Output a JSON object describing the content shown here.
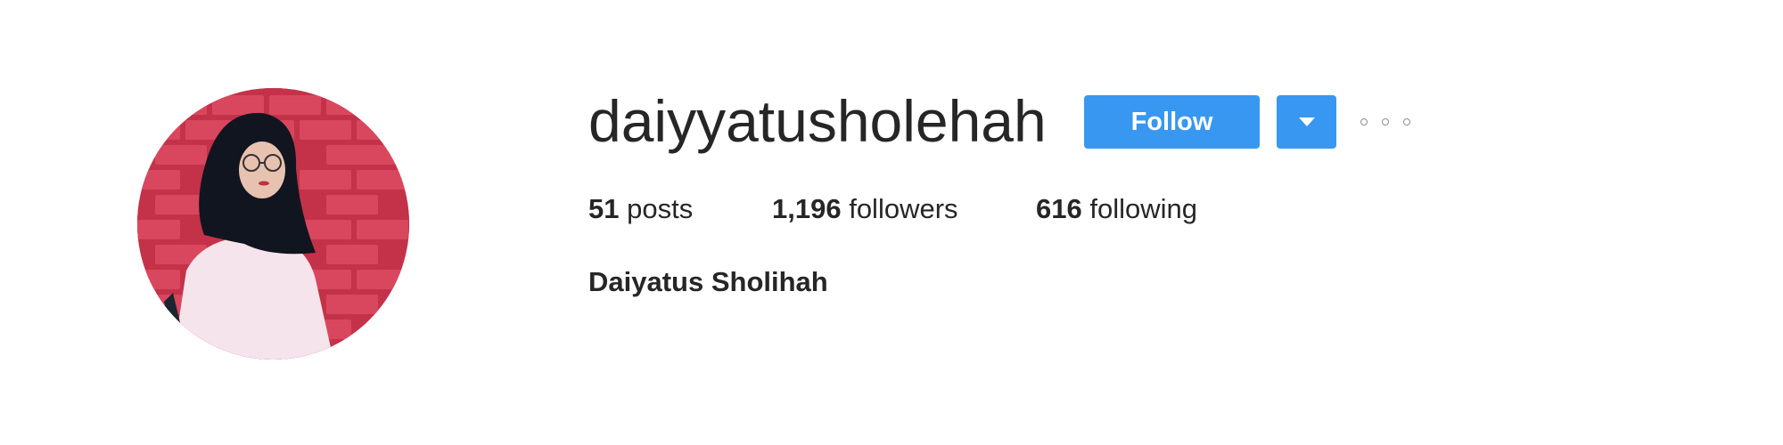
{
  "profile": {
    "username": "daiyyatusholehah",
    "full_name": "Daiyatus Sholihah",
    "follow_label": "Follow",
    "stats": {
      "posts_count": "51",
      "posts_label": "posts",
      "followers_count": "1,196",
      "followers_label": "followers",
      "following_count": "616",
      "following_label": "following"
    }
  },
  "icons": {
    "dropdown": "caret-down-icon",
    "options": "more-options-icon"
  },
  "colors": {
    "primary_button": "#3897f0",
    "text": "#262626",
    "background": "#ffffff"
  }
}
